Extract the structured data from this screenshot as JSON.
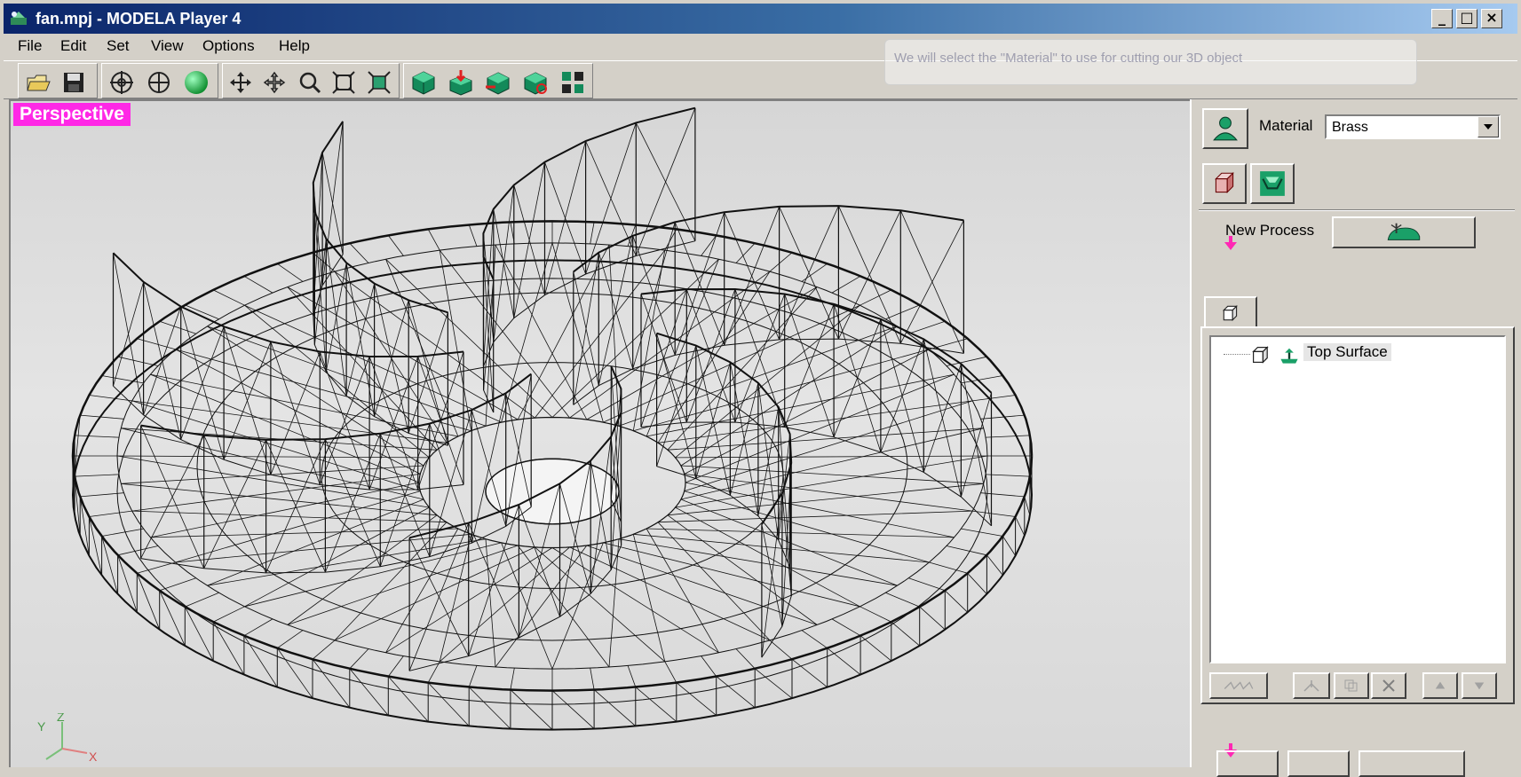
{
  "window": {
    "title": "fan.mpj - MODELA Player 4",
    "caption_buttons": [
      "_",
      "□",
      "×"
    ]
  },
  "menu": [
    "File",
    "Edit",
    "Set",
    "View",
    "Options",
    "Help"
  ],
  "toolbar": {
    "file_icons": [
      "open-folder-icon",
      "save-disk-icon"
    ],
    "view_icons": [
      "rotate-view-icon",
      "move-origin-icon",
      "sphere-render-icon"
    ],
    "nav_icons": [
      "pan-icon",
      "move-icon",
      "zoom-icon",
      "zoom-fit-icon",
      "zoom-all-icon"
    ],
    "process_icons": [
      "green-cube-icon",
      "cube-down-icon",
      "cube-cut-icon",
      "cube-rotate-icon",
      "grid-icon"
    ]
  },
  "hint": "We will select the \"Material\" to use for cutting our 3D object",
  "viewport": {
    "view_mode": "Perspective",
    "axes": [
      "Y",
      "Z",
      "X"
    ]
  },
  "panel": {
    "material_label": "Material",
    "material_value": "Brass",
    "new_process_label": "New Process",
    "tree_items": [
      {
        "label": "Top Surface"
      }
    ]
  },
  "colors": {
    "view_label_bg": "#ff28e6",
    "arrow": "#ff28b4",
    "icon_green": "#1aa068"
  }
}
